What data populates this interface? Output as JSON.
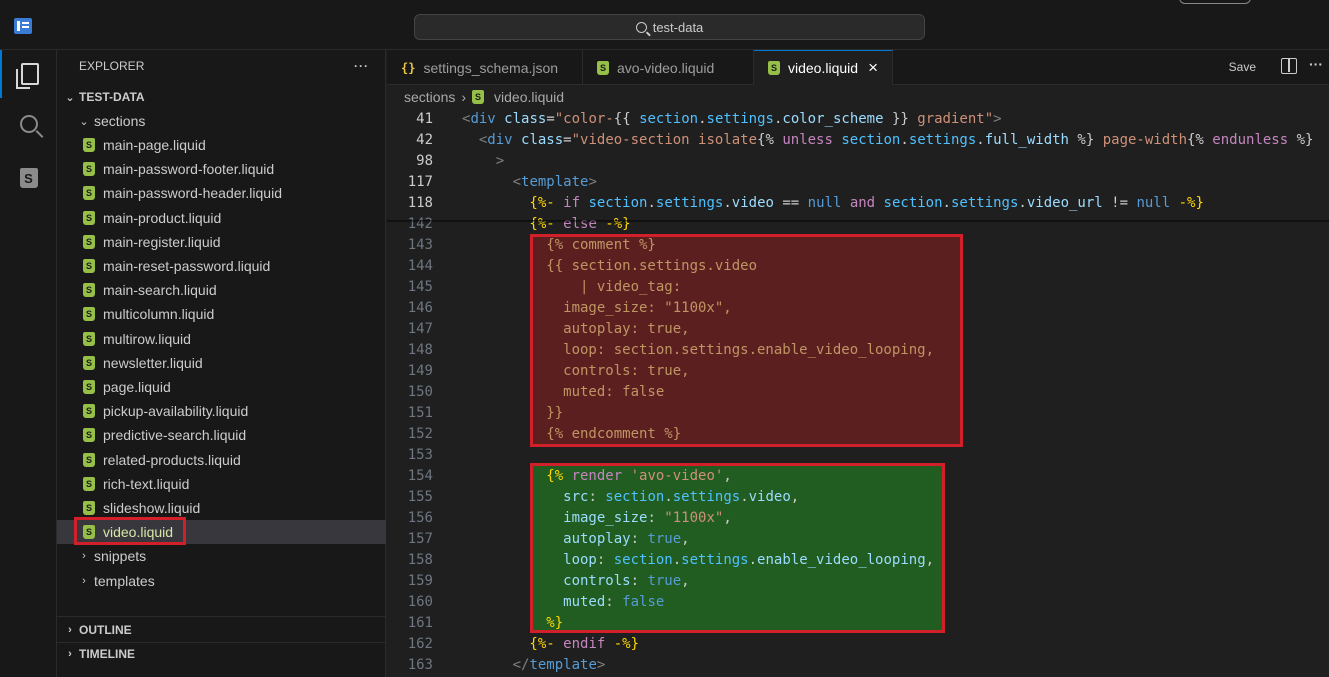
{
  "titlebar": {
    "search": "test-data"
  },
  "sidebar": {
    "title": "EXPLORER",
    "more": "···",
    "root": "TEST-DATA",
    "folder_sections": "sections",
    "files": [
      "main-page.liquid",
      "main-password-footer.liquid",
      "main-password-header.liquid",
      "main-product.liquid",
      "main-register.liquid",
      "main-reset-password.liquid",
      "main-search.liquid",
      "multicolumn.liquid",
      "multirow.liquid",
      "newsletter.liquid",
      "page.liquid",
      "pickup-availability.liquid",
      "predictive-search.liquid",
      "related-products.liquid",
      "rich-text.liquid",
      "slideshow.liquid",
      "video.liquid"
    ],
    "folder_snippets": "snippets",
    "folder_templates": "templates",
    "outline": "OUTLINE",
    "timeline": "TIMELINE"
  },
  "tabs": [
    {
      "label": "settings_schema.json",
      "icon": "json-icon"
    },
    {
      "label": "avo-video.liquid",
      "icon": "shopify-icon"
    },
    {
      "label": "video.liquid",
      "icon": "shopify-icon",
      "active": true
    }
  ],
  "toolbar": {
    "save": "Save"
  },
  "breadcrumb": {
    "folder": "sections",
    "file": "video.liquid"
  },
  "code": {
    "numbers": [
      "41",
      "42",
      "98",
      "117",
      "118",
      "142",
      "143",
      "144",
      "145",
      "146",
      "147",
      "148",
      "149",
      "150",
      "151",
      "152",
      "153",
      "154",
      "155",
      "156",
      "157",
      "158",
      "159",
      "160",
      "161",
      "162",
      "163"
    ]
  },
  "colors": {
    "highlight_border": "#d2202b",
    "comment_bg": "#5c1f1f",
    "render_bg": "#215c21",
    "accent": "#0078d4"
  }
}
